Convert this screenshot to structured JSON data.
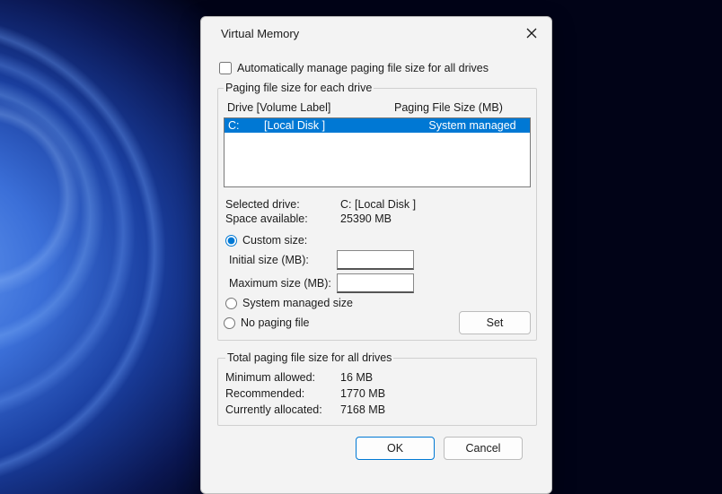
{
  "window": {
    "title": "Virtual Memory"
  },
  "auto_manage": {
    "label": "Automatically manage paging file size for all drives",
    "checked": false
  },
  "drive_section": {
    "legend": "Paging file size for each drive",
    "header_drive": "Drive  [Volume Label]",
    "header_size": "Paging File Size (MB)",
    "rows": [
      {
        "drive": "C:",
        "label": "[Local Disk ]",
        "size": "System managed",
        "selected": true
      }
    ]
  },
  "selected": {
    "drive_label": "Selected drive:",
    "drive_value": "C:  [Local Disk ]",
    "space_label": "Space available:",
    "space_value": "25390 MB"
  },
  "options": {
    "custom_label": "Custom size:",
    "initial_label": "Initial size (MB):",
    "initial_value": "",
    "max_label": "Maximum size (MB):",
    "max_value": "",
    "system_label": "System managed size",
    "none_label": "No paging file",
    "selected": "custom",
    "set_label": "Set"
  },
  "totals": {
    "legend": "Total paging file size for all drives",
    "min_label": "Minimum allowed:",
    "min_value": "16 MB",
    "rec_label": "Recommended:",
    "rec_value": "1770 MB",
    "cur_label": "Currently allocated:",
    "cur_value": "7168 MB"
  },
  "buttons": {
    "ok": "OK",
    "cancel": "Cancel"
  }
}
